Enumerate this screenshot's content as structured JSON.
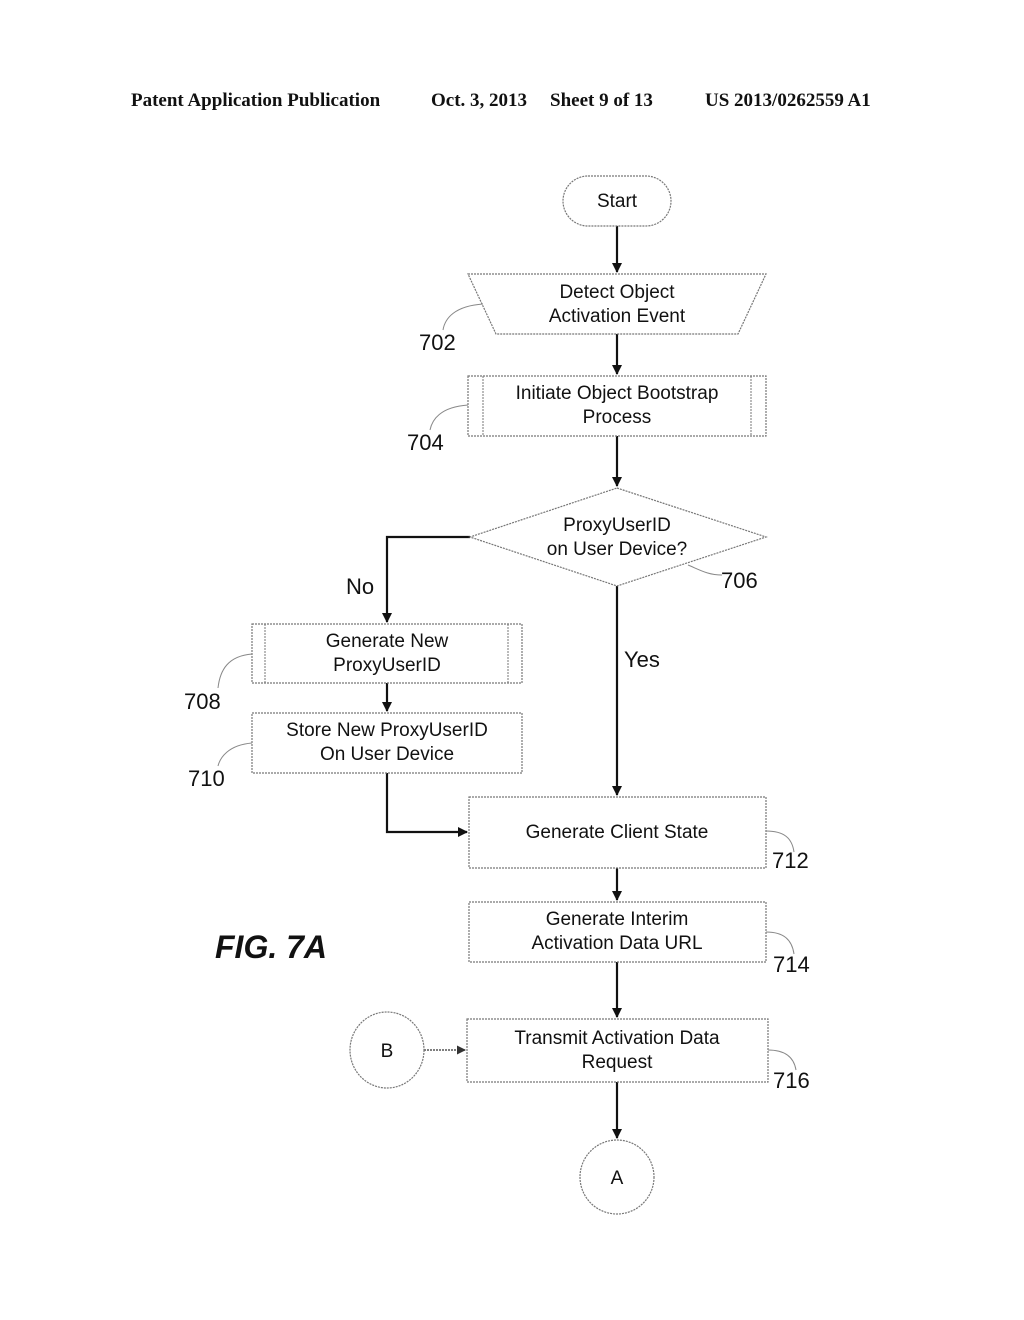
{
  "header": {
    "publication": "Patent Application Publication",
    "date": "Oct. 3, 2013",
    "sheet": "Sheet 9 of 13",
    "number": "US 2013/0262559 A1"
  },
  "figure": {
    "label": "FIG. 7A"
  },
  "nodes": {
    "start": {
      "type": "terminator",
      "lines": [
        "Start"
      ]
    },
    "n702": {
      "type": "manual-input",
      "ref": "702",
      "lines": [
        "Detect Object",
        "Activation Event"
      ]
    },
    "n704": {
      "type": "predefined-process",
      "ref": "704",
      "lines": [
        "Initiate Object Bootstrap",
        "Process"
      ]
    },
    "n706": {
      "type": "decision",
      "ref": "706",
      "lines": [
        "ProxyUserID",
        "on User Device?"
      ]
    },
    "n708": {
      "type": "predefined-process",
      "ref": "708",
      "lines": [
        "Generate New",
        "ProxyUserID"
      ]
    },
    "n710": {
      "type": "process",
      "ref": "710",
      "lines": [
        "Store New ProxyUserID",
        "On User Device"
      ]
    },
    "n712": {
      "type": "process",
      "ref": "712",
      "lines": [
        "Generate Client State"
      ]
    },
    "n714": {
      "type": "process",
      "ref": "714",
      "lines": [
        "Generate Interim",
        "Activation Data URL"
      ]
    },
    "n716": {
      "type": "process",
      "ref": "716",
      "lines": [
        "Transmit Activation Data",
        "Request"
      ]
    },
    "connB": {
      "type": "connector",
      "lines": [
        "B"
      ]
    },
    "connA": {
      "type": "connector",
      "lines": [
        "A"
      ]
    }
  },
  "edges": [
    {
      "from": "start",
      "to": "n702",
      "label": ""
    },
    {
      "from": "n702",
      "to": "n704",
      "label": ""
    },
    {
      "from": "n704",
      "to": "n706",
      "label": ""
    },
    {
      "from": "n706",
      "to": "n708",
      "label": "No"
    },
    {
      "from": "n706",
      "to": "n712",
      "label": "Yes"
    },
    {
      "from": "n708",
      "to": "n710",
      "label": ""
    },
    {
      "from": "n710",
      "to": "n712",
      "label": ""
    },
    {
      "from": "n712",
      "to": "n714",
      "label": ""
    },
    {
      "from": "n714",
      "to": "n716",
      "label": ""
    },
    {
      "from": "connB",
      "to": "n716",
      "label": ""
    },
    {
      "from": "n716",
      "to": "connA",
      "label": ""
    }
  ]
}
